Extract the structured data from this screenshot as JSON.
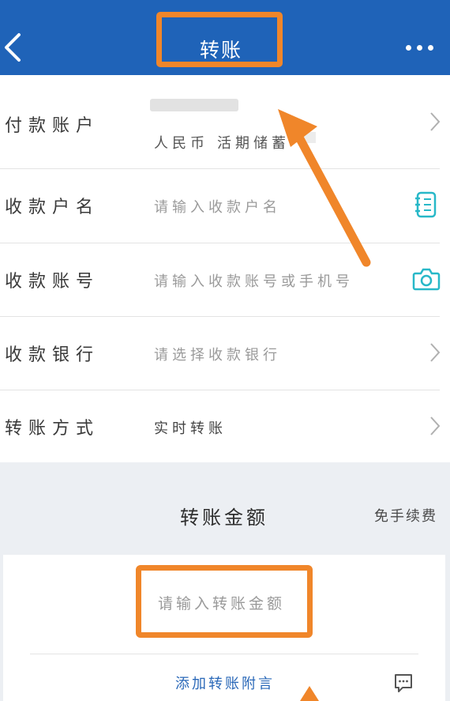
{
  "header": {
    "title": "转账",
    "back_icon": "chevron-left-icon",
    "more_icon": "more-horizontal-icon",
    "background_color": "#1f63b8"
  },
  "form": {
    "payer": {
      "label": "付款账户",
      "currency": "人民币",
      "account_type": "活期储蓄"
    },
    "payee_name": {
      "label": "收款户名",
      "placeholder": "请输入收款户名",
      "icon": "contact-book-icon"
    },
    "payee_account": {
      "label": "收款账号",
      "placeholder": "请输入收款账号或手机号",
      "icon": "camera-icon"
    },
    "payee_bank": {
      "label": "收款银行",
      "placeholder": "请选择收款银行"
    },
    "transfer_method": {
      "label": "转账方式",
      "value": "实时转账"
    }
  },
  "amount": {
    "title": "转账金额",
    "fee_note": "免手续费",
    "placeholder": "请输入转账金额",
    "memo_link": "添加转账附言",
    "memo_icon": "message-icon"
  },
  "annotation_color": "#f0862a",
  "accent_color": "#2a68b8"
}
